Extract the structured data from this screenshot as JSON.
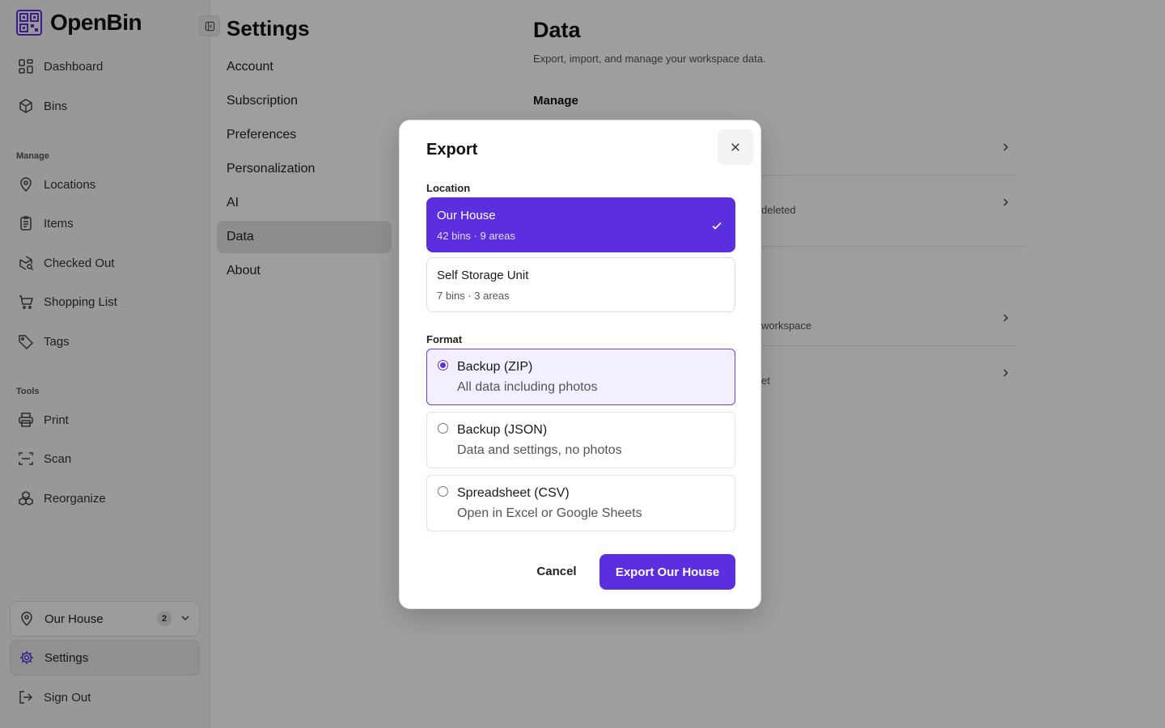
{
  "app": {
    "name": "OpenBin"
  },
  "sidebar": {
    "nav": [
      {
        "label": "Dashboard"
      },
      {
        "label": "Bins"
      }
    ],
    "manage_label": "Manage",
    "manage": [
      {
        "label": "Locations"
      },
      {
        "label": "Items"
      },
      {
        "label": "Checked Out"
      },
      {
        "label": "Shopping List"
      },
      {
        "label": "Tags"
      }
    ],
    "tools_label": "Tools",
    "tools": [
      {
        "label": "Print"
      },
      {
        "label": "Scan"
      },
      {
        "label": "Reorganize"
      }
    ],
    "workspace": {
      "name": "Our House",
      "badge": "2"
    },
    "settings_label": "Settings",
    "signout_label": "Sign Out"
  },
  "settings_nav": {
    "title": "Settings",
    "items": [
      {
        "label": "Account"
      },
      {
        "label": "Subscription"
      },
      {
        "label": "Preferences"
      },
      {
        "label": "Personalization"
      },
      {
        "label": "AI"
      },
      {
        "label": "Data"
      },
      {
        "label": "About"
      }
    ],
    "active": "Data"
  },
  "data_page": {
    "title": "Data",
    "subtitle": "Export, import, and manage your workspace data.",
    "section": "Manage",
    "partial_rows": [
      "deleted",
      "workspace",
      "et"
    ]
  },
  "modal": {
    "title": "Export",
    "location_label": "Location",
    "locations": [
      {
        "name": "Our House",
        "meta": "42 bins · 9 areas",
        "selected": true
      },
      {
        "name": "Self Storage Unit",
        "meta": "7 bins · 3 areas",
        "selected": false
      }
    ],
    "format_label": "Format",
    "formats": [
      {
        "name": "Backup (ZIP)",
        "desc": "All data including photos",
        "selected": true
      },
      {
        "name": "Backup (JSON)",
        "desc": "Data and settings, no photos",
        "selected": false
      },
      {
        "name": "Spreadsheet (CSV)",
        "desc": "Open in Excel or Google Sheets",
        "selected": false
      }
    ],
    "cancel_label": "Cancel",
    "export_label": "Export Our House"
  },
  "colors": {
    "accent": "#5b2fe0",
    "accent_soft": "#f3effe"
  }
}
